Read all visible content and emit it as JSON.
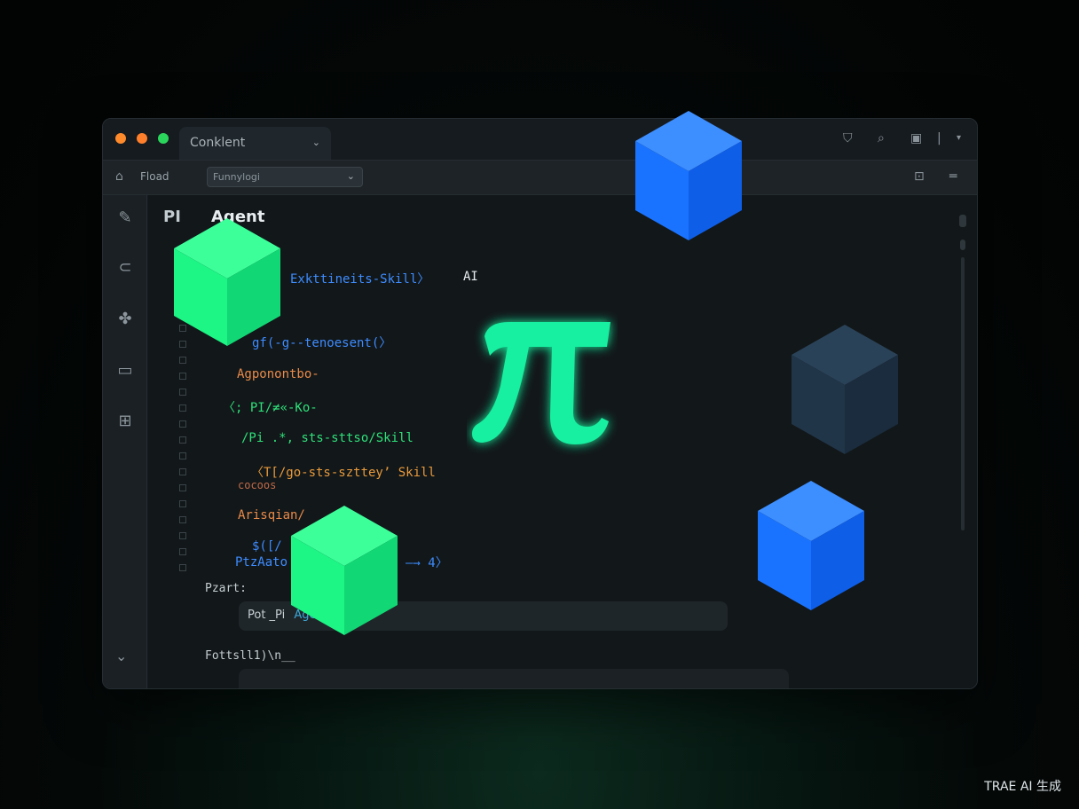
{
  "window": {
    "tab_label": "Conklent",
    "toolbar_label": "Fload",
    "select_value": "Funnylogi",
    "heading_pi": "PI",
    "heading_agent": "Agent"
  },
  "code_lines": [
    {
      "text": "Exkttineits-Skill〉",
      "color": "#3d8cff"
    },
    {
      "text": "AI",
      "color": "#e6ecef"
    },
    {
      "text": "gf(-g--tenoesent(〉",
      "color": "#3d8cff"
    },
    {
      "text": "Agponontbo-",
      "color": "#e88a4a"
    },
    {
      "text": "〈;  PI/≠«-Ko-",
      "color": "#2ee07a"
    },
    {
      "text": "/Pi .*, sts-sttso/Skill",
      "color": "#2ee07a"
    },
    {
      "text": "〈T[/go-sts-sztteyʼ Skill",
      "color": "#e89a3c"
    },
    {
      "text": "cocoos",
      "color": "#c06a48"
    },
    {
      "text": "Arisqian/",
      "color": "#e88a4a"
    },
    {
      "text": "$([/",
      "color": "#3d8cff"
    },
    {
      "text": "PtzAato",
      "color": "#3d8cff"
    },
    {
      "text": "—→ 4〉",
      "color": "#3d8cff"
    },
    {
      "text": "Pzart:",
      "color": "#c5ced2"
    },
    {
      "text": "Fottsll1)\\n__",
      "color": "#c5ced2"
    }
  ],
  "input": {
    "prefix": "Pot _Pi",
    "agent": "Agent"
  },
  "pi_glyph": "π",
  "watermark": "TRAE AI 生成",
  "colors": {
    "accent_green": "#1ef58a",
    "accent_blue": "#1479ff",
    "cube_dark": "#22394d",
    "pi_green": "#19f0a0"
  },
  "icons": {
    "titlebar": [
      "shield-icon",
      "search-icon",
      "chat-icon",
      "more-icon"
    ],
    "sidebar": [
      "edit-icon",
      "link-icon",
      "extensions-icon",
      "monitor-icon",
      "panel-icon"
    ]
  }
}
